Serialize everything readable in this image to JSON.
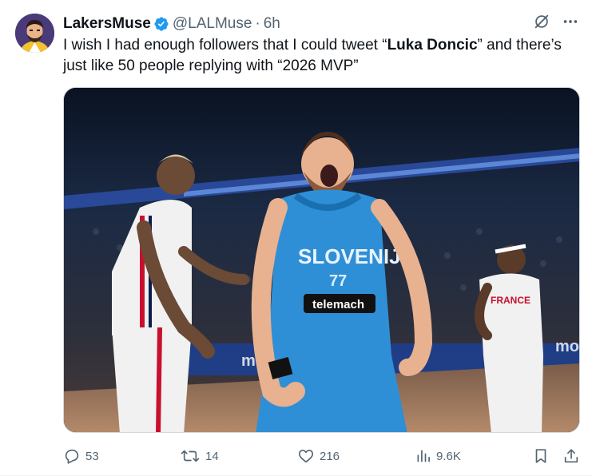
{
  "tweet": {
    "author": {
      "display_name": "LakersMuse",
      "handle": "@LALMuse",
      "separator": "·",
      "time": "6h",
      "verified": true,
      "avatar_icon": "cartoon-avatar"
    },
    "text": {
      "part1": "I wish I had enough followers that I could tweet “",
      "bold": "Luka Doncic",
      "part2": "” and there’s just like 50 people replying with “2026 MVP”"
    },
    "media": {
      "jersey_text": "SLOVENIJA",
      "jersey_number": "77",
      "sponsor": "telemach",
      "right_player_jersey": "FRANCE"
    },
    "actions": {
      "replies": "53",
      "reposts": "14",
      "likes": "216",
      "views": "9.6K"
    },
    "icons": [
      "grok-icon",
      "more-icon",
      "reply-icon",
      "repost-icon",
      "like-icon",
      "views-icon",
      "bookmark-icon",
      "share-icon"
    ],
    "colors": {
      "verified": "#1d9bf0",
      "text": "#0f1419",
      "muted": "#536471"
    }
  }
}
